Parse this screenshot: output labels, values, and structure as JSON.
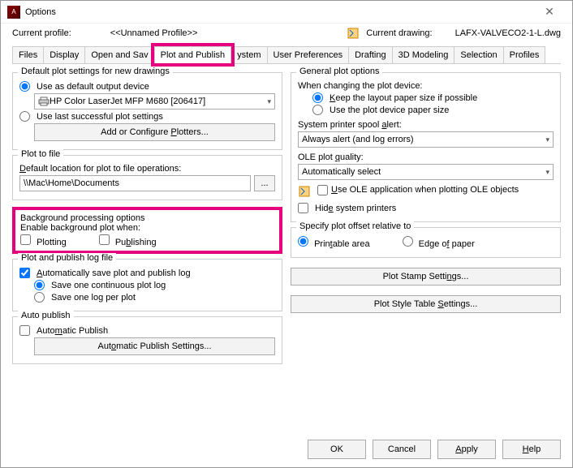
{
  "window": {
    "title": "Options"
  },
  "profile": {
    "label": "Current profile:",
    "value": "<<Unnamed Profile>>",
    "drawing_label": "Current drawing:",
    "drawing_value": "LAFX-VALVECO2-1-L.dwg"
  },
  "tabs": {
    "files": "Files",
    "display": "Display",
    "open_save": "Open and Sav",
    "plot_publish": "Plot and Publish",
    "system": "ystem",
    "user_pref": "User Preferences",
    "drafting": "Drafting",
    "modeling": "3D Modeling",
    "selection": "Selection",
    "profiles": "Profiles"
  },
  "left": {
    "default_plot": {
      "legend": "Default plot settings for new drawings",
      "use_default": "Use as default output device",
      "printer": "HP Color LaserJet MFP M680 [206417]",
      "use_last": "Use last successful plot settings",
      "configure_btn": "Add or Configure Plotters..."
    },
    "plot_to_file": {
      "legend": "Plot to file",
      "default_loc_label": "Default location for plot to file operations:",
      "path": "\\\\Mac\\Home\\Documents"
    },
    "background": {
      "legend": "Background processing options",
      "enable_label": "Enable background plot when:",
      "plotting": "Plotting",
      "publishing": "Publishing"
    },
    "logfile": {
      "legend": "Plot and publish log file",
      "auto_save": "Automatically save plot and publish log",
      "one_continuous": "Save one continuous plot log",
      "one_per_plot": "Save one log per plot"
    },
    "auto_publish": {
      "legend": "Auto publish",
      "automatic": "Automatic Publish",
      "settings_btn": "Automatic Publish Settings..."
    }
  },
  "right": {
    "general": {
      "legend": "General plot options",
      "changing_label": "When changing the plot device:",
      "keep_layout": "Keep the layout paper size if possible",
      "use_device": "Use the plot device paper size",
      "spool_label": "System printer spool alert:",
      "spool_value": "Always alert (and log errors)",
      "ole_quality_label": "OLE plot quality:",
      "ole_quality_value": "Automatically select",
      "use_ole": "Use OLE application when plotting OLE objects",
      "hide_printers": "Hide system printers"
    },
    "offset": {
      "legend": "Specify plot offset relative to",
      "printable": "Printable area",
      "edge": "Edge of paper"
    },
    "stamp_btn": "Plot Stamp Settings...",
    "style_btn": "Plot Style Table Settings..."
  },
  "buttons": {
    "ok": "OK",
    "cancel": "Cancel",
    "apply": "Apply",
    "help": "Help"
  }
}
